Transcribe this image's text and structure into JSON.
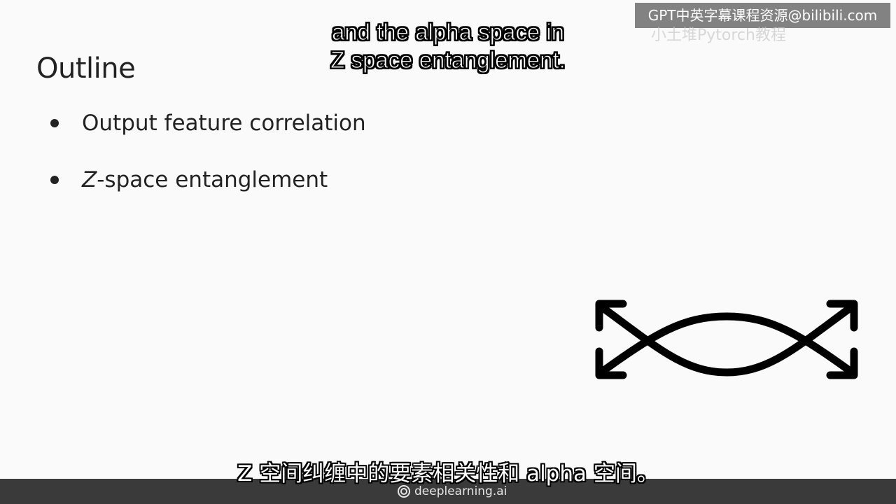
{
  "watermark": {
    "text": "GPT中英字幕课程资源@bilibili.com",
    "subtext": "小土堆Pytorch教程"
  },
  "slide": {
    "title": "Outline",
    "bullets": [
      {
        "prefix": "",
        "italic": "",
        "text": "Output feature correlation"
      },
      {
        "prefix": "",
        "italic": "Z",
        "text": "-space entanglement"
      }
    ],
    "icon": "entanglement-arrows-icon"
  },
  "subtitles": {
    "english_line1": "and the alpha space in",
    "english_line2": "Z space entanglement.",
    "chinese": "Z 空间纠缠中的要素相关性和 alpha 空间。"
  },
  "footer": {
    "brand": "deeplearning.ai",
    "logo_icon": "deeplearning-logo-icon"
  },
  "colors": {
    "background": "#fafafa",
    "text": "#222222",
    "footer_bar": "#3a3a3a"
  }
}
